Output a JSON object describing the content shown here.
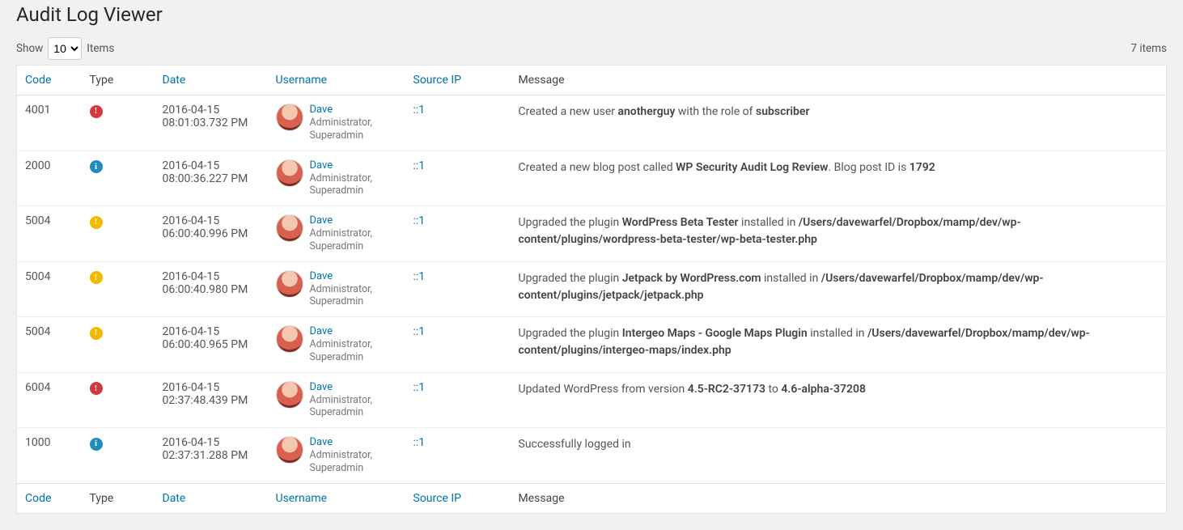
{
  "page_title": "Audit Log Viewer",
  "toolbar": {
    "show_label": "Show",
    "items_label": "Items",
    "per_page": "10",
    "total_items_text": "7 items"
  },
  "columns": {
    "code": {
      "label": "Code",
      "sortable": true
    },
    "type": {
      "label": "Type",
      "sortable": false
    },
    "date": {
      "label": "Date",
      "sortable": true
    },
    "username": {
      "label": "Username",
      "sortable": true
    },
    "source_ip": {
      "label": "Source IP",
      "sortable": true
    },
    "message": {
      "label": "Message",
      "sortable": false
    }
  },
  "type_glyph": {
    "critical": "!",
    "info": "i",
    "warning": "!"
  },
  "rows": [
    {
      "code": "4001",
      "type": "critical",
      "date_line1": "2016-04-15",
      "date_line2": "08:01:03.732 PM",
      "user_name": "Dave",
      "user_role": "Administrator, Superadmin",
      "ip": "::1",
      "msg": "Created a new user <strong>anotherguy</strong> with the role of <strong>subscriber</strong>"
    },
    {
      "code": "2000",
      "type": "info",
      "date_line1": "2016-04-15",
      "date_line2": "08:00:36.227 PM",
      "user_name": "Dave",
      "user_role": "Administrator, Superadmin",
      "ip": "::1",
      "msg": "Created a new blog post called <strong>WP Security Audit Log Review</strong>. Blog post ID is <strong>1792</strong>"
    },
    {
      "code": "5004",
      "type": "warning",
      "date_line1": "2016-04-15",
      "date_line2": "06:00:40.996 PM",
      "user_name": "Dave",
      "user_role": "Administrator, Superadmin",
      "ip": "::1",
      "msg": "Upgraded the plugin <strong>WordPress Beta Tester</strong> installed in <strong>/Users/davewarfel/Dropbox/mamp/dev/wp-content/plugins/wordpress-beta-tester/wp-beta-tester.php</strong>"
    },
    {
      "code": "5004",
      "type": "warning",
      "date_line1": "2016-04-15",
      "date_line2": "06:00:40.980 PM",
      "user_name": "Dave",
      "user_role": "Administrator, Superadmin",
      "ip": "::1",
      "msg": "Upgraded the plugin <strong>Jetpack by WordPress.com</strong> installed in <strong>/Users/davewarfel/Dropbox/mamp/dev/wp-content/plugins/jetpack/jetpack.php</strong>"
    },
    {
      "code": "5004",
      "type": "warning",
      "date_line1": "2016-04-15",
      "date_line2": "06:00:40.965 PM",
      "user_name": "Dave",
      "user_role": "Administrator, Superadmin",
      "ip": "::1",
      "msg": "Upgraded the plugin <strong>Intergeo Maps - Google Maps Plugin</strong> installed in <strong>/Users/davewarfel/Dropbox/mamp/dev/wp-content/plugins/intergeo-maps/index.php</strong>"
    },
    {
      "code": "6004",
      "type": "critical",
      "date_line1": "2016-04-15",
      "date_line2": "02:37:48.439 PM",
      "user_name": "Dave",
      "user_role": "Administrator, Superadmin",
      "ip": "::1",
      "msg": "Updated WordPress from version <strong>4.5-RC2-37173</strong> to <strong>4.6-alpha-37208</strong>"
    },
    {
      "code": "1000",
      "type": "info",
      "date_line1": "2016-04-15",
      "date_line2": "02:37:31.288 PM",
      "user_name": "Dave",
      "user_role": "Administrator, Superadmin",
      "ip": "::1",
      "msg": "Successfully logged in"
    }
  ]
}
